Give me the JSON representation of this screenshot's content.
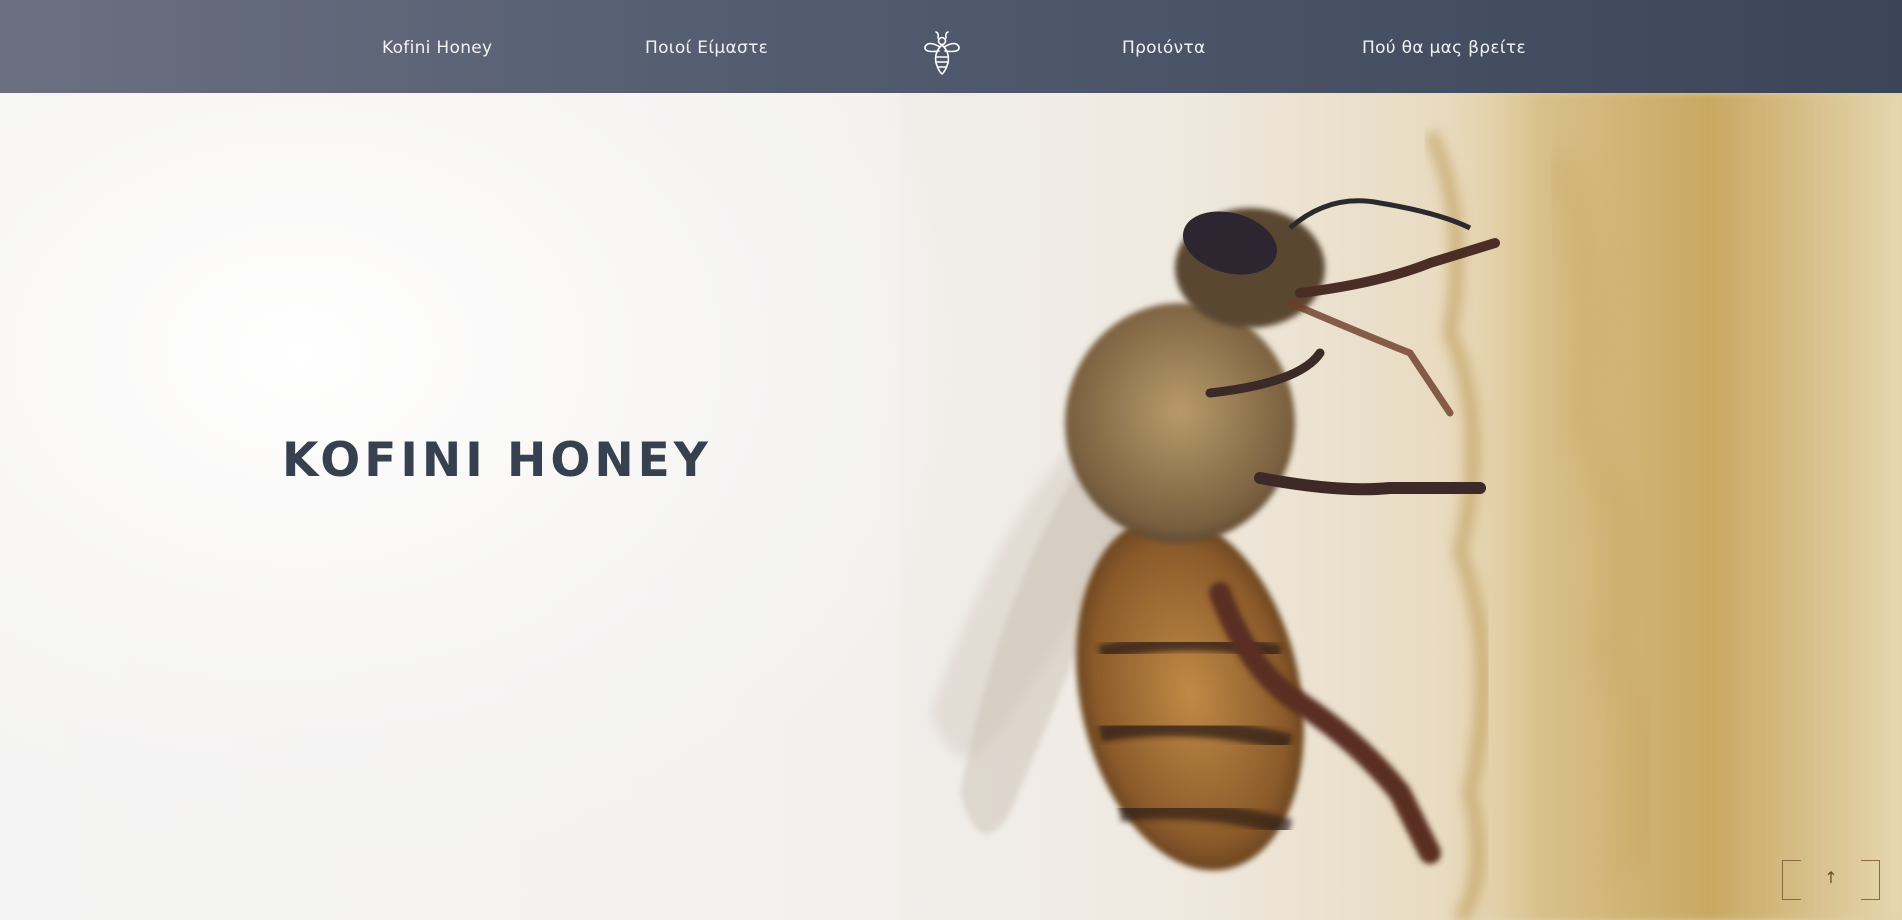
{
  "nav": {
    "items": [
      {
        "label": "Kofini Honey"
      },
      {
        "label": "Ποιοί Είμαστε"
      },
      {
        "label": "Προιόντα"
      },
      {
        "label": "Πού θα μας βρείτε"
      }
    ],
    "logo_icon": "bee-icon"
  },
  "hero": {
    "title": "KOFINI HONEY",
    "image": "bee-on-honeycomb-photo"
  },
  "back_to_top": {
    "label": "↑",
    "icon": "arrow-up-icon"
  },
  "colors": {
    "nav_start": "#6b7081",
    "nav_end": "#3c4558",
    "title": "#37404f",
    "accent": "#8a6a3d"
  }
}
